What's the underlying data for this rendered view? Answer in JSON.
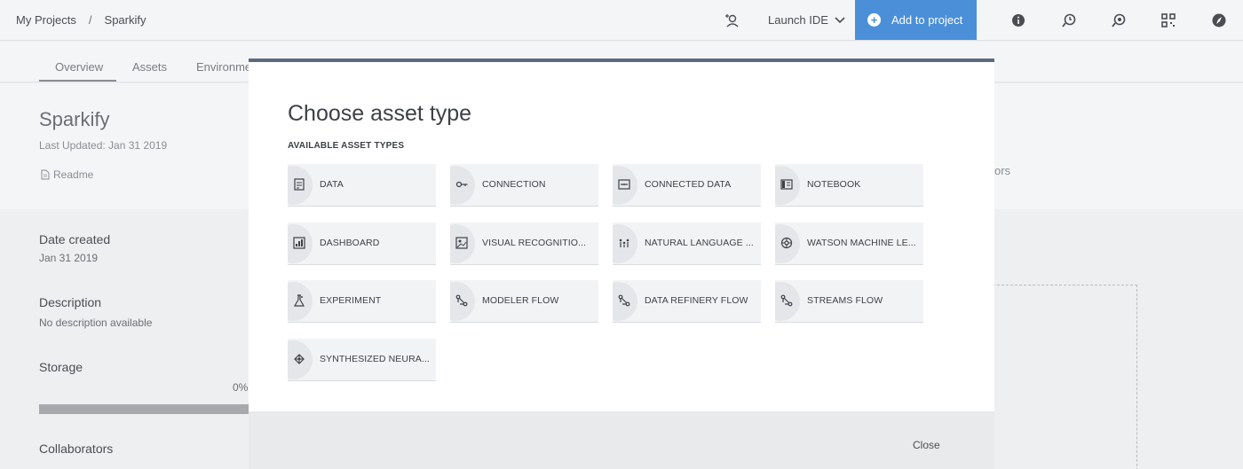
{
  "topbar": {
    "breadcrumb_root": "My Projects",
    "breadcrumb_sep": "/",
    "breadcrumb_current": "Sparkify",
    "launch_label": "Launch IDE",
    "add_label": "Add to project",
    "icons": [
      "add-collaborator-icon",
      "info-icon",
      "history-icon",
      "feedback-icon",
      "qr-code-icon",
      "compass-icon"
    ]
  },
  "tabs": [
    "Overview",
    "Assets",
    "Environme"
  ],
  "project": {
    "title": "Sparkify",
    "updated": "Last Updated: Jan 31 2019",
    "readme": "Readme",
    "date_label": "Date created",
    "date_value": "Jan 31 2019",
    "desc_label": "Description",
    "desc_value": "No description available",
    "storage_label": "Storage",
    "storage_pct": "0%",
    "collab_label": "Collaborators",
    "side_text": "ors"
  },
  "modal": {
    "title": "Choose asset type",
    "subtitle": "AVAILABLE ASSET TYPES",
    "close_label": "Close",
    "tiles": [
      {
        "label": "DATA",
        "icon": "data-icon"
      },
      {
        "label": "CONNECTION",
        "icon": "connection-icon"
      },
      {
        "label": "CONNECTED DATA",
        "icon": "connected-data-icon"
      },
      {
        "label": "NOTEBOOK",
        "icon": "notebook-icon"
      },
      {
        "label": "DASHBOARD",
        "icon": "dashboard-icon"
      },
      {
        "label": "VISUAL RECOGNITIO...",
        "icon": "visual-recognition-icon"
      },
      {
        "label": "NATURAL LANGUAGE ...",
        "icon": "natural-language-icon"
      },
      {
        "label": "WATSON MACHINE LE...",
        "icon": "machine-learning-icon"
      },
      {
        "label": "EXPERIMENT",
        "icon": "experiment-icon"
      },
      {
        "label": "MODELER FLOW",
        "icon": "flow-icon"
      },
      {
        "label": "DATA REFINERY FLOW",
        "icon": "flow-icon"
      },
      {
        "label": "STREAMS FLOW",
        "icon": "flow-icon"
      },
      {
        "label": "SYNTHESIZED NEURA...",
        "icon": "neural-network-icon"
      }
    ]
  }
}
